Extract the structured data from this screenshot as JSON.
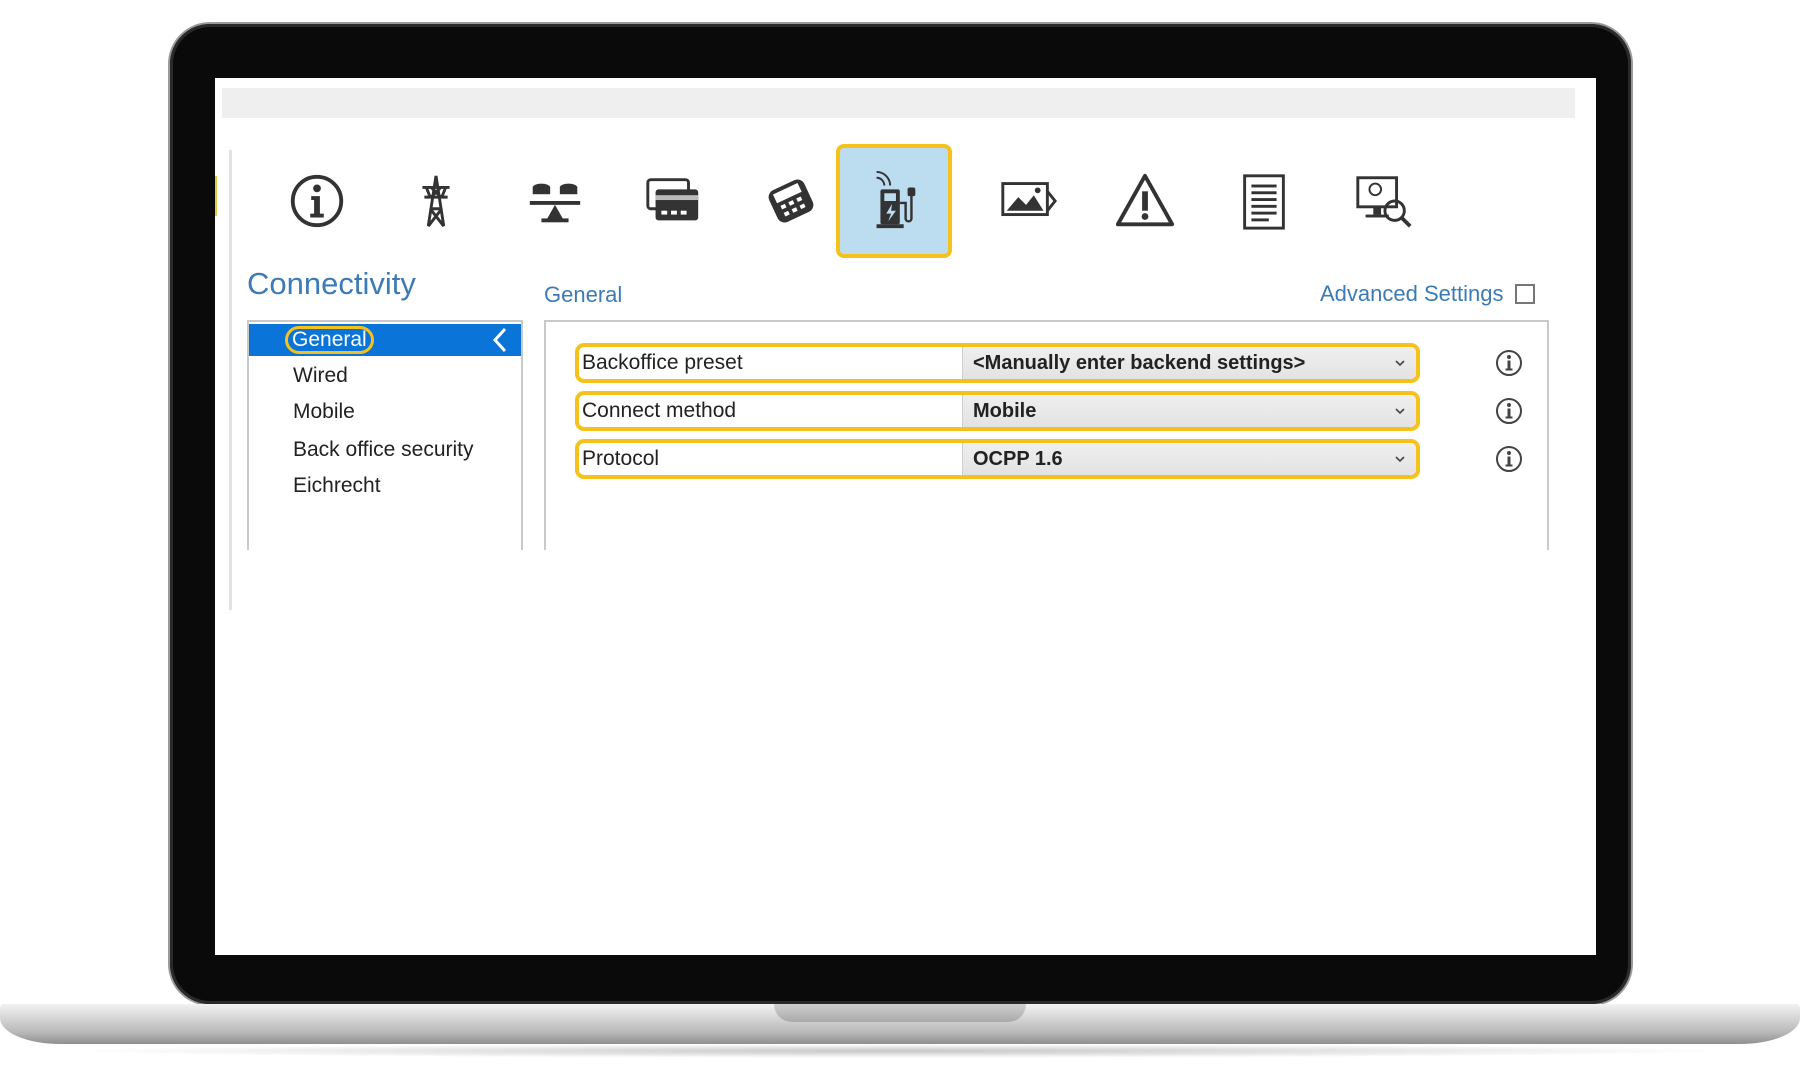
{
  "connectivity": {
    "section_title": "Connectivity",
    "panel_title": "General",
    "advanced_settings_label": "Advanced Settings",
    "advanced_settings_checked": false
  },
  "toolbar": {
    "tabs": [
      {
        "icon": "info-icon",
        "active": false
      },
      {
        "icon": "power-pylon-icon",
        "active": false
      },
      {
        "icon": "load-balance-icon",
        "active": false
      },
      {
        "icon": "card-icon",
        "active": false
      },
      {
        "icon": "payment-terminal-icon",
        "active": false
      },
      {
        "icon": "charging-station-connectivity-icon",
        "active": true
      },
      {
        "icon": "display-image-icon",
        "active": false
      },
      {
        "icon": "warning-icon",
        "active": false
      },
      {
        "icon": "document-icon",
        "active": false
      },
      {
        "icon": "diagnostics-monitor-icon",
        "active": false
      }
    ]
  },
  "nav": {
    "items": [
      {
        "label": "General",
        "selected": true
      },
      {
        "label": "Wired",
        "selected": false
      },
      {
        "label": "Mobile",
        "selected": false
      },
      {
        "label": "Back office security",
        "selected": false
      },
      {
        "label": "Eichrecht",
        "selected": false
      }
    ]
  },
  "form": {
    "backoffice_preset": {
      "label": "Backoffice preset",
      "value": "<Manually enter backend settings>"
    },
    "connect_method": {
      "label": "Connect method",
      "value": "Mobile"
    },
    "protocol": {
      "label": "Protocol",
      "value": "OCPP 1.6"
    }
  },
  "colors": {
    "accent_blue": "#3c7bb5",
    "selection_blue": "#0a74d9",
    "highlight_yellow": "#f4c21a",
    "active_tab_bg": "#bcdcf0"
  }
}
